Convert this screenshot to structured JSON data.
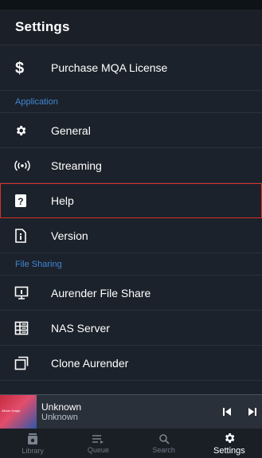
{
  "header": {
    "title": "Settings"
  },
  "top_item": {
    "label": "Purchase MQA License",
    "icon": "dollar-icon"
  },
  "sections": [
    {
      "title": "Application",
      "items": [
        {
          "label": "General",
          "icon": "gear-icon"
        },
        {
          "label": "Streaming",
          "icon": "streaming-icon"
        },
        {
          "label": "Help",
          "icon": "help-icon"
        },
        {
          "label": "Version",
          "icon": "version-icon"
        }
      ]
    },
    {
      "title": "File Sharing",
      "items": [
        {
          "label": "Aurender File Share",
          "icon": "file-share-icon"
        },
        {
          "label": "NAS Server",
          "icon": "nas-server-icon"
        },
        {
          "label": "Clone Aurender",
          "icon": "clone-icon"
        }
      ]
    }
  ],
  "now_playing": {
    "title": "Unknown",
    "subtitle": "Unknown",
    "art_text": "Album Image"
  },
  "tabs": [
    {
      "label": "Library",
      "icon": "library-icon"
    },
    {
      "label": "Queue",
      "icon": "queue-icon"
    },
    {
      "label": "Search",
      "icon": "search-icon"
    },
    {
      "label": "Settings",
      "icon": "gear-icon",
      "active": true
    }
  ],
  "colors": {
    "background": "#1c222b",
    "accent_section": "#3f86d6",
    "selection_outline": "#d8312a"
  }
}
